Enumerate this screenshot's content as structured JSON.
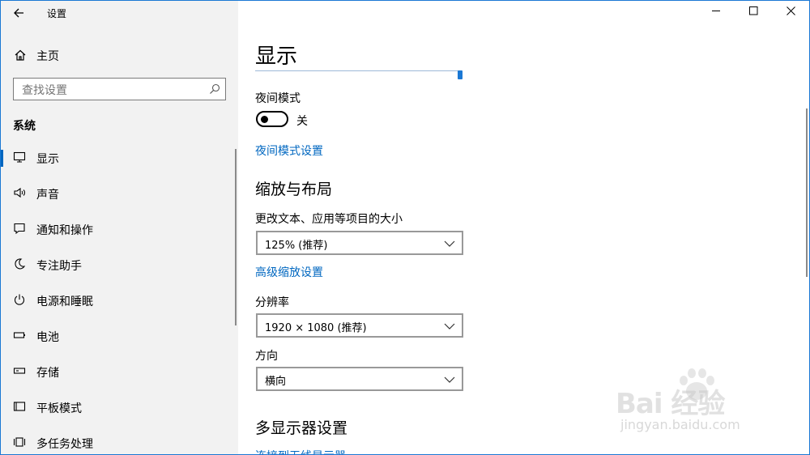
{
  "window": {
    "title": "设置",
    "back_icon": "arrow-left-icon",
    "controls": {
      "minimize": "—",
      "maximize": "☐",
      "close": "✕"
    }
  },
  "sidebar": {
    "home_label": "主页",
    "search_placeholder": "查找设置",
    "section_title": "系统",
    "items": [
      {
        "label": "显示",
        "icon": "monitor-icon",
        "glyph": "🖵",
        "active": true
      },
      {
        "label": "声音",
        "icon": "speaker-icon",
        "glyph": "🕪",
        "active": false
      },
      {
        "label": "通知和操作",
        "icon": "message-icon",
        "glyph": "🗨",
        "active": false
      },
      {
        "label": "专注助手",
        "icon": "moon-icon",
        "glyph": "☾",
        "active": false
      },
      {
        "label": "电源和睡眠",
        "icon": "power-icon",
        "glyph": "⏻",
        "active": false
      },
      {
        "label": "电池",
        "icon": "battery-icon",
        "glyph": "▭",
        "active": false
      },
      {
        "label": "存储",
        "icon": "storage-icon",
        "glyph": "▭",
        "active": false
      },
      {
        "label": "平板模式",
        "icon": "tablet-icon",
        "glyph": "⊏",
        "active": false
      },
      {
        "label": "多任务处理",
        "icon": "multitask-icon",
        "glyph": "⊟",
        "active": false
      }
    ]
  },
  "main": {
    "page_title": "显示",
    "night_mode": {
      "label": "夜间模式",
      "state": "关",
      "settings_link": "夜间模式设置"
    },
    "scale_layout": {
      "heading": "缩放与布局",
      "text_size_label": "更改文本、应用等项目的大小",
      "text_size_value": "125% (推荐)",
      "advanced_link": "高级缩放设置",
      "resolution_label": "分辨率",
      "resolution_value": "1920 × 1080 (推荐)",
      "orientation_label": "方向",
      "orientation_value": "横向"
    },
    "multi_display": {
      "heading": "多显示器设置",
      "link": "连接到无线显示器"
    }
  },
  "watermark": {
    "brand": "Bai 经验",
    "url": "jingyan.baidu.com"
  }
}
